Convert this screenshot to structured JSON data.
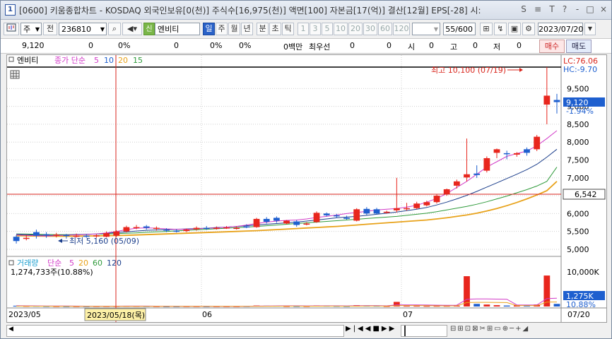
{
  "window": {
    "icon_label": "1",
    "title": "[0600] 키움종합차트 - KOSDAQ 외국인보유[0(천)] 주식수[16,975(천)] 액면[100] 자본금[17(억)] 결산[12월] EPS[-28] 시:",
    "title_buttons": [
      "S",
      "≡",
      "T",
      "?",
      "-",
      "□",
      "×"
    ]
  },
  "toolbar": {
    "stock_type": "주",
    "prev_label": "전",
    "code": "236810",
    "badge_sin": "신",
    "stock_name": "엔비티",
    "period_buttons": [
      "일",
      "주",
      "월",
      "년",
      "분",
      "초",
      "틱"
    ],
    "active_period": "일",
    "interval_buttons": [
      "1",
      "3",
      "5",
      "10",
      "20",
      "30",
      "60",
      "120"
    ],
    "count": "55/600",
    "date": "2023/07/20"
  },
  "infobar": {
    "price": "9,120",
    "change": "0",
    "rate1": "0%",
    "vol": "0",
    "rate2": "0%",
    "rate3": "0%",
    "amount": "0백만",
    "pref_label": "최우선",
    "pref_val": "0",
    "pref_val2": "0",
    "open_label": "시",
    "open_val": "0",
    "high_label": "고",
    "high_val": "0",
    "low_label": "저",
    "low_val": "0",
    "buy_label": "매수",
    "sell_label": "매도"
  },
  "price_panel": {
    "legend_name": "엔비티",
    "legend_type": "종가 단순",
    "ma_labels": [
      "5",
      "10",
      "20",
      "15"
    ],
    "lc_label": "LC:76.06",
    "hc_label": "HC:-9.70",
    "high_annotation": "최고 10,100 (07/19)",
    "low_annotation": "최저 5,160 (05/09)",
    "current_price_tag": "9,120",
    "current_rate_tag": "-1.94%",
    "crosshair_price_tag": "6,542",
    "y_ticks": [
      "9,500",
      "9,000",
      "8,500",
      "8,000",
      "7,500",
      "7,000",
      "6,500",
      "6,000",
      "5,500",
      "5,000"
    ]
  },
  "volume_panel": {
    "legend_name": "거래량",
    "legend_type": "단순",
    "ma_labels": [
      "5",
      "20",
      "60",
      "120"
    ],
    "last_volume": "1,274,733주(10.88%)",
    "y_tick": "10,000K",
    "current_tag": "1,275K",
    "current_rate": "10.88%"
  },
  "x_axis": {
    "labels": [
      "2023/05",
      "06",
      "07",
      "07/20"
    ],
    "crosshair_date": "2023/05/18(목)"
  },
  "colors": {
    "up": "#e8261d",
    "down": "#1e5fcf",
    "ma5": "#d23cc8",
    "ma10": "#1c3f8c",
    "ma20": "#2e9a3a",
    "ma60": "#e8a21a",
    "crosshair": "#d9261d",
    "tag_blue": "#1e5fcf"
  },
  "chart_data": {
    "type": "candlestick",
    "ylim": [
      4900,
      10100
    ],
    "candles": [
      {
        "o": 5350,
        "c": 5230,
        "h": 5400,
        "l": 5160
      },
      {
        "o": 5300,
        "c": 5320,
        "h": 5400,
        "l": 5250
      },
      {
        "o": 5480,
        "c": 5380,
        "h": 5550,
        "l": 5300
      },
      {
        "o": 5420,
        "c": 5400,
        "h": 5480,
        "l": 5320
      },
      {
        "o": 5410,
        "c": 5410,
        "h": 5460,
        "l": 5330
      },
      {
        "o": 5400,
        "c": 5370,
        "h": 5430,
        "l": 5300
      },
      {
        "o": 5380,
        "c": 5380,
        "h": 5440,
        "l": 5330
      },
      {
        "o": 5380,
        "c": 5360,
        "h": 5420,
        "l": 5320
      },
      {
        "o": 5360,
        "c": 5390,
        "h": 5420,
        "l": 5320
      },
      {
        "o": 5350,
        "c": 5450,
        "h": 5500,
        "l": 5330
      },
      {
        "o": 5380,
        "c": 5500,
        "h": 5530,
        "l": 5350
      },
      {
        "o": 5500,
        "c": 5620,
        "h": 5660,
        "l": 5470
      },
      {
        "o": 5620,
        "c": 5620,
        "h": 5680,
        "l": 5560
      },
      {
        "o": 5640,
        "c": 5600,
        "h": 5680,
        "l": 5550
      },
      {
        "o": 5580,
        "c": 5600,
        "h": 5640,
        "l": 5520
      },
      {
        "o": 5550,
        "c": 5520,
        "h": 5590,
        "l": 5480
      },
      {
        "o": 5520,
        "c": 5510,
        "h": 5560,
        "l": 5470
      },
      {
        "o": 5510,
        "c": 5550,
        "h": 5580,
        "l": 5480
      },
      {
        "o": 5560,
        "c": 5600,
        "h": 5640,
        "l": 5520
      },
      {
        "o": 5600,
        "c": 5580,
        "h": 5650,
        "l": 5540
      },
      {
        "o": 5580,
        "c": 5600,
        "h": 5640,
        "l": 5550
      },
      {
        "o": 5610,
        "c": 5610,
        "h": 5650,
        "l": 5570
      },
      {
        "o": 5580,
        "c": 5600,
        "h": 5640,
        "l": 5550
      },
      {
        "o": 5640,
        "c": 5620,
        "h": 5700,
        "l": 5590
      },
      {
        "o": 5620,
        "c": 5850,
        "h": 5880,
        "l": 5600
      },
      {
        "o": 5850,
        "c": 5770,
        "h": 5900,
        "l": 5720
      },
      {
        "o": 5880,
        "c": 5800,
        "h": 5920,
        "l": 5740
      },
      {
        "o": 5720,
        "c": 5800,
        "h": 5820,
        "l": 5700
      },
      {
        "o": 5780,
        "c": 5680,
        "h": 5820,
        "l": 5630
      },
      {
        "o": 5700,
        "c": 5720,
        "h": 5760,
        "l": 5670
      },
      {
        "o": 5760,
        "c": 6020,
        "h": 6060,
        "l": 5740
      },
      {
        "o": 6000,
        "c": 5950,
        "h": 6030,
        "l": 5920
      },
      {
        "o": 5950,
        "c": 5920,
        "h": 5990,
        "l": 5880
      },
      {
        "o": 5880,
        "c": 5870,
        "h": 5940,
        "l": 5830
      },
      {
        "o": 5800,
        "c": 6120,
        "h": 6150,
        "l": 5780
      },
      {
        "o": 6130,
        "c": 6000,
        "h": 6180,
        "l": 5960
      },
      {
        "o": 6120,
        "c": 6000,
        "h": 6160,
        "l": 5970
      },
      {
        "o": 6030,
        "c": 6050,
        "h": 6080,
        "l": 6000
      },
      {
        "o": 6090,
        "c": 6150,
        "h": 7000,
        "l": 6030
      },
      {
        "o": 6150,
        "c": 6150,
        "h": 6300,
        "l": 6080
      },
      {
        "o": 6150,
        "c": 6280,
        "h": 6330,
        "l": 6120
      },
      {
        "o": 6230,
        "c": 6320,
        "h": 6360,
        "l": 6200
      },
      {
        "o": 6320,
        "c": 6500,
        "h": 6530,
        "l": 6280
      },
      {
        "o": 6550,
        "c": 6680,
        "h": 6700,
        "l": 6500
      },
      {
        "o": 6780,
        "c": 6900,
        "h": 6950,
        "l": 6700
      },
      {
        "o": 7010,
        "c": 7100,
        "h": 8100,
        "l": 6900
      },
      {
        "o": 7120,
        "c": 7080,
        "h": 7350,
        "l": 7000
      },
      {
        "o": 7200,
        "c": 7550,
        "h": 7600,
        "l": 7150
      },
      {
        "o": 7700,
        "c": 7800,
        "h": 7820,
        "l": 7550
      },
      {
        "o": 7690,
        "c": 7680,
        "h": 7760,
        "l": 7520
      },
      {
        "o": 7650,
        "c": 7690,
        "h": 7720,
        "l": 7590
      },
      {
        "o": 7800,
        "c": 7700,
        "h": 7850,
        "l": 7620
      },
      {
        "o": 7800,
        "c": 8150,
        "h": 8200,
        "l": 7750
      },
      {
        "o": 9050,
        "c": 9300,
        "h": 10100,
        "l": 8500
      },
      {
        "o": 9180,
        "c": 9120,
        "h": 9350,
        "l": 8800
      }
    ],
    "ma5": [
      5400,
      5390,
      5380,
      5370,
      5380,
      5395,
      5405,
      5415,
      5430,
      5460,
      5500,
      5550,
      5590,
      5600,
      5590,
      5570,
      5560,
      5560,
      5570,
      5590,
      5600,
      5620,
      5640,
      5680,
      5720,
      5760,
      5790,
      5810,
      5820,
      5850,
      5890,
      5920,
      5960,
      6000,
      6030,
      6060,
      6100,
      6120,
      6140,
      6180,
      6230,
      6320,
      6420,
      6560,
      6730,
      6900,
      7100,
      7300,
      7450,
      7600,
      7680,
      7750,
      7900,
      8100,
      8320
    ],
    "ma10": [
      5420,
      5410,
      5400,
      5390,
      5390,
      5400,
      5410,
      5420,
      5430,
      5450,
      5470,
      5490,
      5510,
      5530,
      5540,
      5550,
      5560,
      5570,
      5580,
      5590,
      5610,
      5620,
      5640,
      5660,
      5680,
      5700,
      5720,
      5740,
      5760,
      5790,
      5820,
      5850,
      5880,
      5900,
      5920,
      5950,
      5980,
      6010,
      6040,
      6080,
      6120,
      6170,
      6240,
      6320,
      6410,
      6510,
      6620,
      6740,
      6860,
      6980,
      7100,
      7230,
      7380,
      7580,
      7800
    ],
    "ma20": [
      5430,
      5425,
      5420,
      5415,
      5410,
      5410,
      5415,
      5420,
      5425,
      5430,
      5440,
      5450,
      5460,
      5475,
      5490,
      5500,
      5515,
      5530,
      5545,
      5560,
      5575,
      5590,
      5605,
      5620,
      5640,
      5660,
      5680,
      5700,
      5720,
      5740,
      5760,
      5780,
      5800,
      5820,
      5840,
      5860,
      5880,
      5900,
      5920,
      5950,
      5980,
      6010,
      6050,
      6100,
      6150,
      6200,
      6260,
      6330,
      6410,
      6490,
      6580,
      6670,
      6770,
      6900,
      7300
    ],
    "ma60": [
      5380,
      5375,
      5370,
      5368,
      5365,
      5365,
      5368,
      5370,
      5375,
      5380,
      5385,
      5390,
      5400,
      5410,
      5420,
      5430,
      5440,
      5450,
      5460,
      5470,
      5480,
      5490,
      5500,
      5510,
      5520,
      5535,
      5550,
      5565,
      5580,
      5595,
      5610,
      5625,
      5640,
      5660,
      5680,
      5700,
      5720,
      5740,
      5760,
      5780,
      5800,
      5820,
      5850,
      5880,
      5920,
      5960,
      6010,
      6070,
      6140,
      6220,
      6310,
      6410,
      6520,
      6640,
      6900
    ],
    "volumes": [
      120,
      80,
      90,
      60,
      50,
      40,
      40,
      40,
      50,
      50,
      60,
      80,
      70,
      60,
      40,
      30,
      30,
      40,
      40,
      30,
      30,
      30,
      30,
      50,
      150,
      120,
      100,
      60,
      60,
      60,
      160,
      100,
      80,
      60,
      200,
      120,
      100,
      60,
      700,
      100,
      100,
      80,
      90,
      90,
      120,
      4600,
      400,
      300,
      200,
      150,
      180,
      150,
      300,
      4700,
      400
    ],
    "vol_ylim": [
      0,
      6000
    ],
    "vol_ma": [
      120,
      110,
      100,
      90,
      80,
      70,
      60,
      55,
      50,
      50,
      55,
      60,
      60,
      60,
      55,
      50,
      45,
      40,
      40,
      40,
      35,
      35,
      35,
      40,
      60,
      80,
      100,
      110,
      110,
      100,
      100,
      110,
      110,
      100,
      120,
      130,
      130,
      110,
      260,
      250,
      240,
      220,
      200,
      180,
      200,
      1100,
      1150,
      1150,
      1130,
      1100,
      250,
      230,
      240,
      1200,
      1250
    ]
  }
}
